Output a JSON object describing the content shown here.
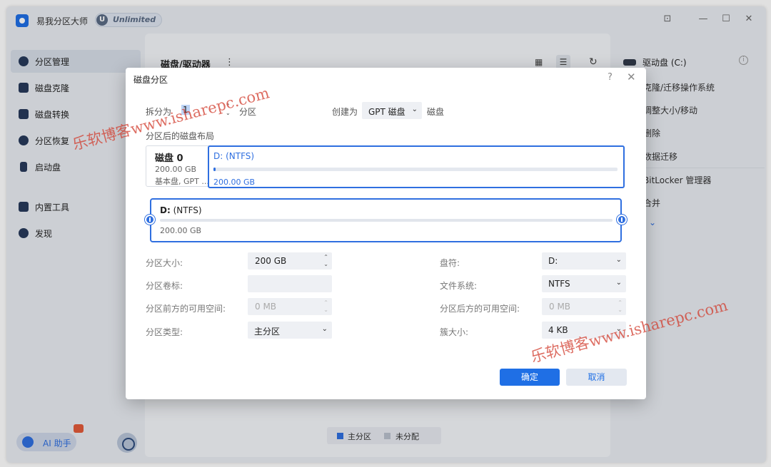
{
  "app": {
    "title": "易我分区大师",
    "badge_letter": "U",
    "badge": "Unlimited",
    "controls": {
      "tray": "⊡",
      "minimize": "—",
      "maximize": "☐",
      "close": "✕"
    }
  },
  "sidebar": {
    "items": [
      {
        "label": "分区管理",
        "icon": "partition-pie-icon",
        "active": true
      },
      {
        "label": "磁盘克隆",
        "icon": "clone-icon",
        "active": false
      },
      {
        "label": "磁盘转换",
        "icon": "convert-icon",
        "active": false
      },
      {
        "label": "分区恢复",
        "icon": "recovery-icon",
        "active": false
      },
      {
        "label": "启动盘",
        "icon": "usb-icon",
        "active": false
      },
      {
        "label": "内置工具",
        "icon": "toolbox-icon",
        "active": false
      },
      {
        "label": "发现",
        "icon": "compass-icon",
        "active": false
      }
    ],
    "ai_label": "AI 助手"
  },
  "main": {
    "title": "磁盘/驱动器",
    "more": "⋮",
    "legend": {
      "primary": "主分区",
      "unallocated": "未分配",
      "primary_color": "#2f6fe0",
      "unallocated_color": "#b9c0cc"
    }
  },
  "right_panel": {
    "drive": "驱动盘 (C:)",
    "info": "i",
    "ops": [
      "克隆/迁移操作系统",
      "调整大小/移动",
      "删除",
      "数据迁移",
      "BitLocker 管理器",
      "合并"
    ],
    "more": "⌄"
  },
  "watermark": "乐软博客www.isharepc.com",
  "dialog": {
    "title": "磁盘分区",
    "help": "?",
    "close": "✕",
    "split_label": "拆分为",
    "split_value": "1",
    "split_unit": "分区",
    "create_as_label": "创建为",
    "disk_type": "GPT 磁盘",
    "disk_suffix": "磁盘",
    "layout_label": "分区后的磁盘布局",
    "disk": {
      "name": "磁盘 0",
      "size": "200.00 GB",
      "type": "基本盘, GPT ..."
    },
    "partition": {
      "name": "D: (NTFS)",
      "size": "200.00 GB"
    },
    "resize": {
      "letter": "D:",
      "fs": "(NTFS)",
      "size": "200.00 GB"
    },
    "fields": {
      "size_label": "分区大小:",
      "size_value": "200 GB",
      "vol_label": "分区卷标:",
      "vol_value": "",
      "before_label": "分区前方的可用空间:",
      "before_value": "0 MB",
      "type_label": "分区类型:",
      "type_value": "主分区",
      "letter_label": "盘符:",
      "letter_value": "D:",
      "fs_label": "文件系统:",
      "fs_value": "NTFS",
      "after_label": "分区后方的可用空间:",
      "after_value": "0 MB",
      "cluster_label": "簇大小:",
      "cluster_value": "4 KB"
    },
    "ok": "确定",
    "cancel": "取消"
  }
}
